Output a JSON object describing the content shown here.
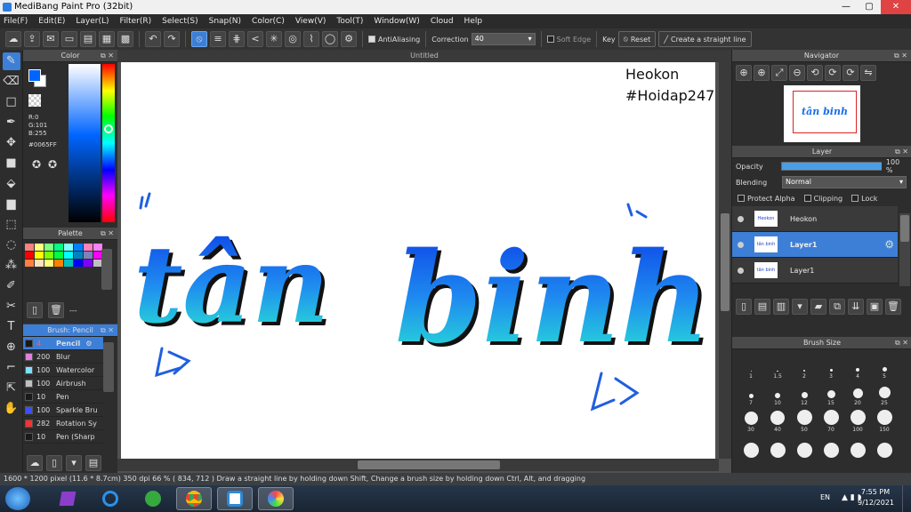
{
  "window": {
    "title": "MediBang Paint Pro (32bit)",
    "min": "—",
    "max": "▢",
    "close": "✕"
  },
  "menu": [
    "File(F)",
    "Edit(E)",
    "Layer(L)",
    "Filter(R)",
    "Select(S)",
    "Snap(N)",
    "Color(C)",
    "View(V)",
    "Tool(T)",
    "Window(W)",
    "Cloud",
    "Help"
  ],
  "toolbar": {
    "antialiasing_label": "AntiAliasing",
    "correction_label": "Correction",
    "correction_value": "40",
    "soft_edge_label": "Soft Edge",
    "key_label": "Key",
    "reset_label": "Reset",
    "straight_line_label": "Create a straight line"
  },
  "color_panel": {
    "title": "Color",
    "r": "R:0",
    "g": "G:101",
    "b": "B:255",
    "hex": "#0065FF",
    "fg_color": "#0065ff"
  },
  "palette_panel": {
    "title": "Palette",
    "colors": [
      "#ff8080",
      "#ffff80",
      "#80ff80",
      "#00ff80",
      "#80ffff",
      "#0080ff",
      "#ff80c0",
      "#ff80ff",
      "#ff0000",
      "#ffff00",
      "#80ff00",
      "#00ff40",
      "#00ffff",
      "#0080c0",
      "#8080c0",
      "#ff00ff",
      "#ff8040",
      "#ffe0c0",
      "#ffff80",
      "#ff8000",
      "#00c0c0",
      "#0000ff",
      "#8000ff",
      "#c0c0c0"
    ],
    "footer_text": "---"
  },
  "brush_panel": {
    "title": "Brush: Pencil",
    "brushes": [
      {
        "size": "4",
        "name": "Pencil",
        "color": "#1a1a1a",
        "selected": true
      },
      {
        "size": "200",
        "name": "Blur",
        "color": "#e080e0",
        "selected": false
      },
      {
        "size": "100",
        "name": "Watercolor",
        "color": "#80e0ff",
        "selected": false
      },
      {
        "size": "100",
        "name": "Airbrush",
        "color": "#c0c0c0",
        "selected": false
      },
      {
        "size": "10",
        "name": "Pen",
        "color": "#1a1a1a",
        "selected": false
      },
      {
        "size": "100",
        "name": "Sparkle Bru",
        "color": "#3a50ff",
        "selected": false
      },
      {
        "size": "282",
        "name": "Rotation Sy",
        "color": "#ff3030",
        "selected": false
      },
      {
        "size": "10",
        "name": "Pen (Sharp",
        "color": "#1a1a1a",
        "selected": false
      }
    ]
  },
  "canvas": {
    "tab_title": "Untitled",
    "watermark_line1": "Heokon",
    "watermark_line2": "#Hoidap247",
    "art_text_word1": "tân",
    "art_text_word2": "binh"
  },
  "navigator": {
    "title": "Navigator",
    "thumb_text": "tân binh"
  },
  "layer_panel": {
    "title": "Layer",
    "opacity_label": "Opacity",
    "opacity_value": "100 %",
    "opacity_fraction": 1.0,
    "blending_label": "Blending",
    "blending_value": "Normal",
    "protect_alpha": "Protect Alpha",
    "clipping": "Clipping",
    "lock": "Lock",
    "layers": [
      {
        "name": "Heokon",
        "selected": false,
        "thumb": "Heokon #Hoidap247"
      },
      {
        "name": "Layer1",
        "selected": true,
        "thumb": "tân binh"
      },
      {
        "name": "Layer1",
        "selected": false,
        "thumb": "tân binh"
      }
    ]
  },
  "brush_size_panel": {
    "title": "Brush Size",
    "sizes": [
      "1",
      "1.5",
      "2",
      "3",
      "4",
      "5",
      "7",
      "10",
      "12",
      "15",
      "20",
      "25",
      "30",
      "40",
      "50",
      "70",
      "100",
      "150",
      "",
      "",
      "",
      "",
      "",
      ""
    ]
  },
  "status": {
    "text": "1600 * 1200 pixel   (11.6 * 8.7cm)   350 dpi   66 %   ( 834, 712 )   Draw a straight line by holding down Shift, Change a brush size by holding down Ctrl, Alt, and dragging"
  },
  "taskbar": {
    "lang": "EN",
    "time": "7:55 PM",
    "date": "9/12/2021"
  }
}
